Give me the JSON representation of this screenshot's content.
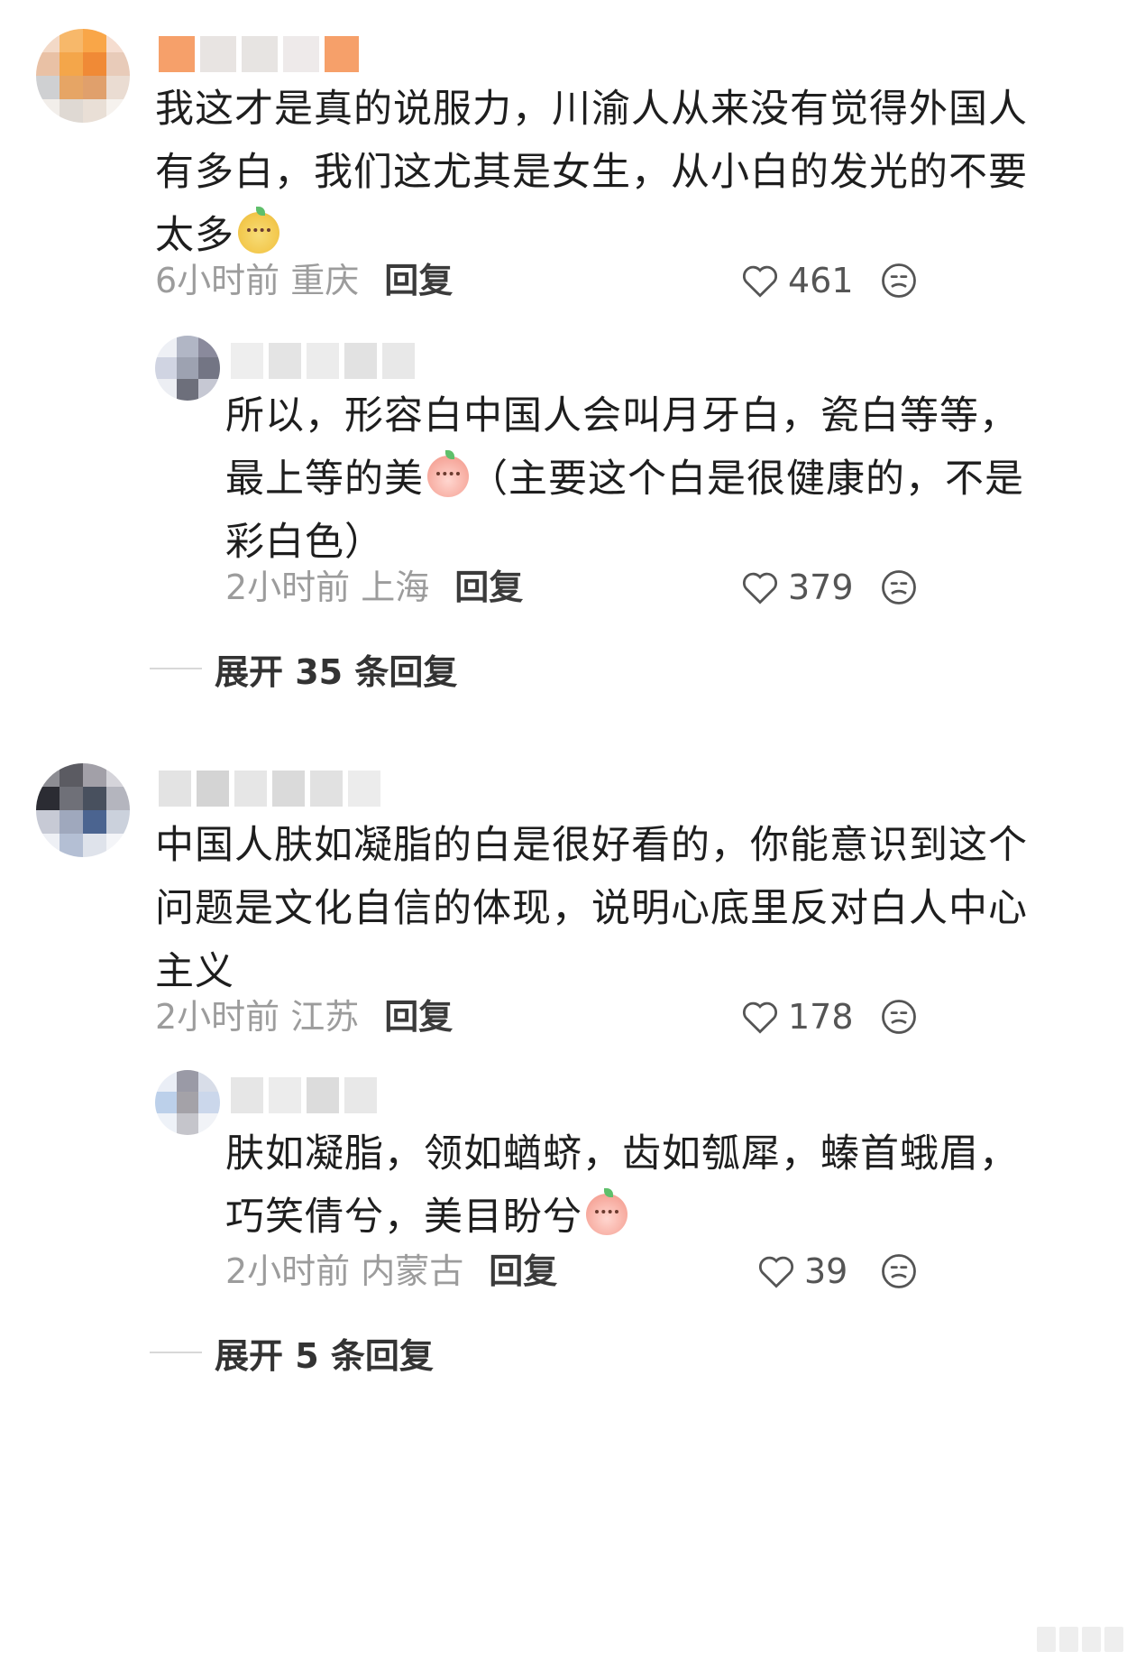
{
  "comments": [
    {
      "body_lines": [
        "我这才是真的说服力，川渝人从来没有觉得外国人",
        "有多白，我们这尤其是女生，从小白的发光的不要",
        "太多"
      ],
      "emoji_name": "dog-face-emoji",
      "time": "6小时前",
      "location": "重庆",
      "reply_label": "回复",
      "likes": "461"
    },
    {
      "body_lines": [
        "所以，形容白中国人会叫月牙白，瓷白等等，",
        "最上等的美",
        "（主要这个白是很健康的，不是",
        "彩白色）"
      ],
      "emoji_name": "peach-blush-emoji",
      "time": "2小时前",
      "location": "上海",
      "reply_label": "回复",
      "likes": "379"
    },
    {
      "body_lines": [
        "中国人肤如凝脂的白是很好看的，你能意识到这个",
        "问题是文化自信的体现，说明心底里反对白人中心",
        "主义"
      ],
      "time": "2小时前",
      "location": "江苏",
      "reply_label": "回复",
      "likes": "178"
    },
    {
      "body_lines": [
        "肤如凝脂，领如蝤蛴，齿如瓠犀，螓首蛾眉，",
        "巧笑倩兮，美目盼兮"
      ],
      "emoji_name": "peach-blush-emoji",
      "time": "2小时前",
      "location": "内蒙古",
      "reply_label": "回复",
      "likes": "39"
    }
  ],
  "expand_replies": [
    "展开 35 条回复",
    "展开 5 条回复"
  ],
  "colors": {
    "text": "#1e1e1e",
    "meta": "#9c9c9c",
    "reply": "#3b3b3b"
  },
  "icons": [
    "heart-icon",
    "dislike-face-icon"
  ]
}
